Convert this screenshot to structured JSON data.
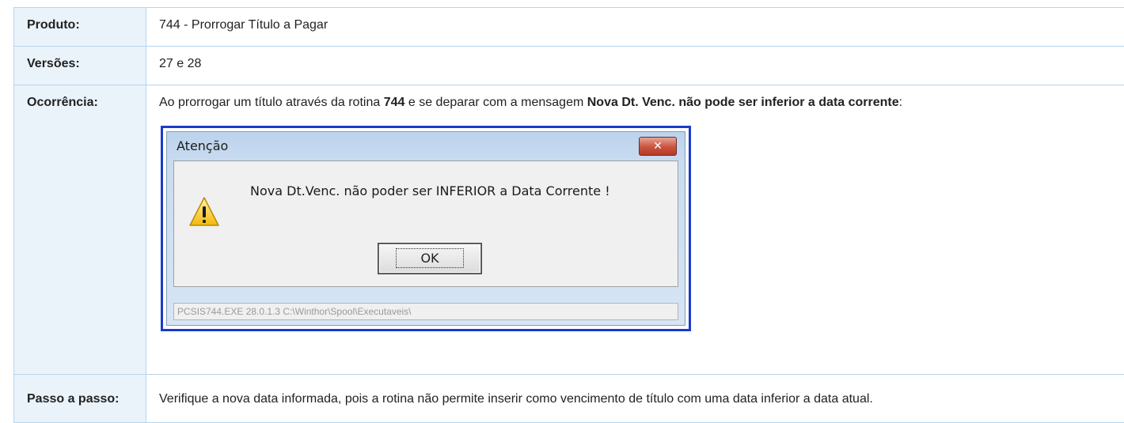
{
  "rows": [
    {
      "label": "Produto:",
      "value": "744 - Prorrogar Título a Pagar"
    },
    {
      "label": "Versões:",
      "value": "27 e 28"
    },
    {
      "label": "Ocorrência:",
      "text_before_1": "Ao prorrogar um título através da rotina ",
      "bold_1": "744",
      "text_between": " e se deparar com a mensagem ",
      "bold_2": "Nova Dt. Venc. não pode ser inferior a data corrente",
      "text_after": ":"
    },
    {
      "label": "Passo a passo:",
      "value": "Verifique a nova data informada, pois a rotina não permite inserir como vencimento de título com uma data inferior a data atual."
    }
  ],
  "dialog": {
    "title": "Atenção",
    "close_glyph": "✕",
    "message": "Nova Dt.Venc. não poder ser INFERIOR a Data Corrente !",
    "ok_label": "OK",
    "status": "PCSIS744.EXE 28.0.1.3 C:\\Winthor\\Spool\\Executaveis\\",
    "icon": "warning-icon"
  },
  "colors": {
    "label_bg": "#eaf3fa",
    "border": "#b6d4ec",
    "dialog_border": "#1a3cc9"
  }
}
